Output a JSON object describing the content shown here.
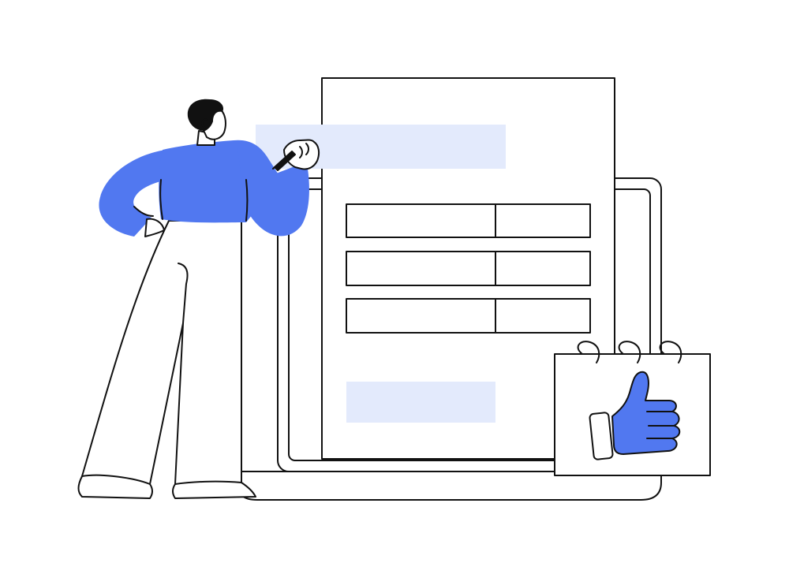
{
  "scene": {
    "description_free": true
  },
  "colors": {
    "background": "#ffffff",
    "outline": "#111111",
    "accent_blue": "#5178F0",
    "light_blue_block": "#E3EAFC",
    "hair": "#111111"
  },
  "icons": {
    "approval": "thumbs-up-icon",
    "calendar": "calendar-icon",
    "pen": "pen-icon"
  },
  "form": {
    "row_count": 3
  }
}
